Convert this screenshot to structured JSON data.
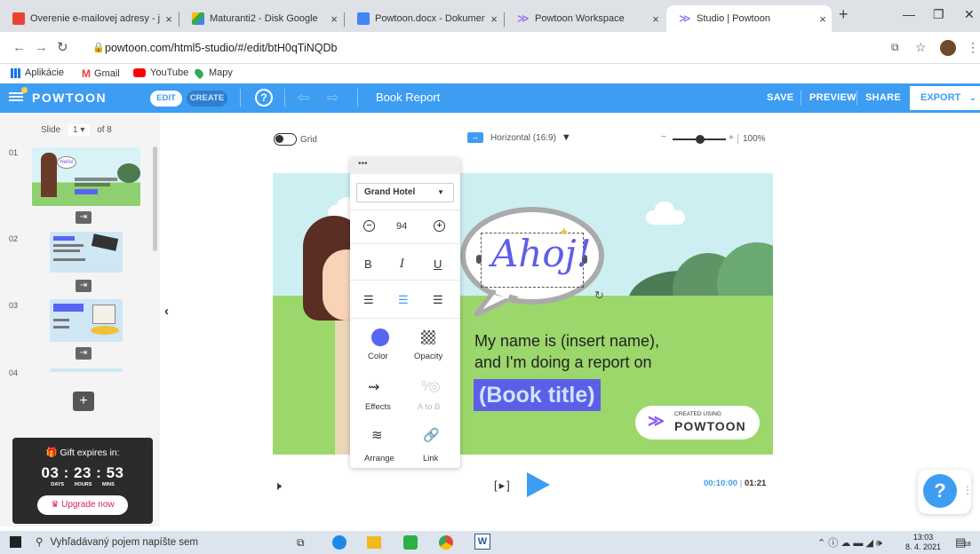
{
  "browser": {
    "tabs": [
      {
        "title": "Overenie e-mailovej adresy - ja",
        "color": "#ea4335"
      },
      {
        "title": "Maturanti2 - Disk Google",
        "color": "#fbbc04"
      },
      {
        "title": "Powtoon.docx - Dokumenty G",
        "color": "#4285f4"
      },
      {
        "title": "Powtoon Workspace",
        "color": "#8b5cf6"
      },
      {
        "title": "Studio | Powtoon",
        "color": "#8b5cf6"
      }
    ],
    "url": "powtoon.com/html5-studio/#/edit/btH0qTiNQDb",
    "bookmarks": [
      "Aplikácie",
      "Gmail",
      "YouTube",
      "Mapy"
    ]
  },
  "powtoon": {
    "logo": "POWTOON",
    "edit_label": "EDIT",
    "create_label": "CREATE",
    "help_symbol": "?",
    "doc_title": "Book Report",
    "save_label": "SAVE",
    "preview_label": "PREVIEW",
    "share_label": "SHARE",
    "export_label": "EXPORT",
    "accent": "#3d9df2"
  },
  "slides": {
    "slide_label": "Slide",
    "current": "1",
    "of_label": "of 8",
    "numbers": [
      "01",
      "02",
      "03",
      "04"
    ]
  },
  "gift": {
    "title": "Gift expires in:",
    "days": "03",
    "hours": "23",
    "mins": "53",
    "days_label": "DAYS",
    "hours_label": "HOURS",
    "mins_label": "MINS",
    "upgrade_label": "Upgrade now"
  },
  "canvas_controls": {
    "grid_label": "Grid",
    "orientation": "Horizontal (16:9)",
    "zoom": "100%"
  },
  "toolbar": {
    "font": "Grand Hotel",
    "size": "94",
    "color_label": "Color",
    "opacity_label": "Opacity",
    "effects_label": "Effects",
    "atob_label": "A to B",
    "arrange_label": "Arrange",
    "link_label": "Link"
  },
  "slide": {
    "bubble_text": "Ahoj!",
    "line1": "My name is (insert name),",
    "line2": "and I'm doing a report on",
    "book_title": "(Book title)",
    "badge_small": "CREATED USING",
    "badge_big": "POWTOON"
  },
  "playback": {
    "current_time": "00:10:00",
    "total_time": "01:21"
  },
  "taskbar": {
    "search_placeholder": "Vyhľadávaný pojem napíšte sem",
    "time": "13:03",
    "date": "8. 4. 2021",
    "notif_count": "18"
  }
}
